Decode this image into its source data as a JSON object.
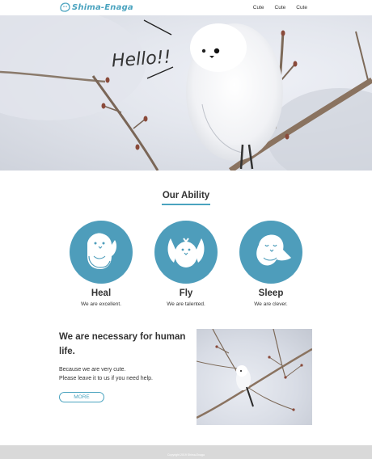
{
  "header": {
    "logo_text": "Shima-Enaga",
    "nav": [
      "Cute",
      "Cute",
      "Cute"
    ]
  },
  "hero": {
    "greeting": "Hello!!"
  },
  "ability": {
    "title": "Our Ability",
    "items": [
      {
        "name": "Heal",
        "desc": "We are excellent."
      },
      {
        "name": "Fly",
        "desc": "We are talented."
      },
      {
        "name": "Sleep",
        "desc": "We are clever."
      }
    ]
  },
  "necessary": {
    "title": "We are necessary for human life.",
    "line1": "Because we are very cute.",
    "line2": "Please leave it to us if you need help.",
    "button": "MORE"
  },
  "footer": {
    "copyright": "Copyright 2019 Shima-Enaga"
  },
  "colors": {
    "accent": "#4aa3bf",
    "circle": "#4e9dbb",
    "footer_bg": "#d9d9d9"
  }
}
